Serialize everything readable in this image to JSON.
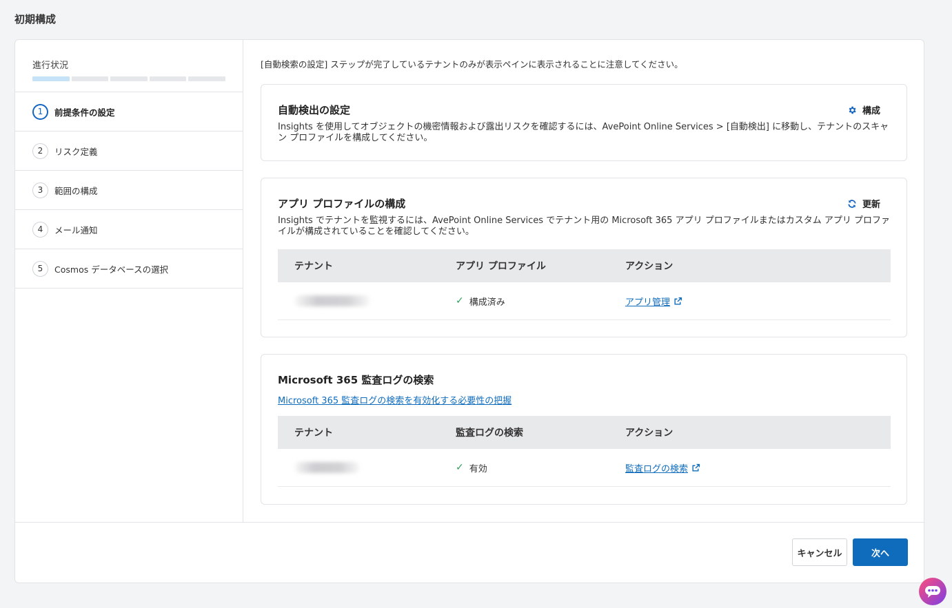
{
  "page": {
    "title": "初期構成"
  },
  "progress": {
    "label": "進行状況",
    "completed_steps": 1,
    "total_steps": 5
  },
  "steps": [
    {
      "num": "1",
      "label": "前提条件の設定",
      "active": true
    },
    {
      "num": "2",
      "label": "リスク定義",
      "active": false
    },
    {
      "num": "3",
      "label": "範囲の構成",
      "active": false
    },
    {
      "num": "4",
      "label": "メール通知",
      "active": false
    },
    {
      "num": "5",
      "label": "Cosmos データベースの選択",
      "active": false
    }
  ],
  "notice": "[自動検索の設定] ステップが完了しているテナントのみが表示ペインに表示されることに注意してください。",
  "auto_detect": {
    "title": "自動検出の設定",
    "action_label": "構成",
    "description": "Insights を使用してオブジェクトの機密情報および露出リスクを確認するには、AvePoint Online Services > [自動検出] に移動し、テナントのスキャン プロファイルを構成してください。"
  },
  "app_profile": {
    "title": "アプリ プロファイルの構成",
    "action_label": "更新",
    "description": "Insights でテナントを監視するには、AvePoint Online Services でテナント用の Microsoft 365 アプリ プロファイルまたはカスタム アプリ プロファイルが構成されていることを確認してください。",
    "columns": [
      "テナント",
      "アプリ プロファイル",
      "アクション"
    ],
    "row": {
      "status": "構成済み",
      "action": "アプリ管理"
    }
  },
  "audit_log": {
    "title": "Microsoft 365 監査ログの検索",
    "link": "Microsoft 365 監査ログの検索を有効化する必要性の把握",
    "columns": [
      "テナント",
      "監査ログの検索",
      "アクション"
    ],
    "row": {
      "status": "有効",
      "action": "監査ログの検索"
    }
  },
  "footer": {
    "cancel": "キャンセル",
    "next": "次へ"
  },
  "colors": {
    "accent": "#0f6cbd",
    "success": "#2e9e5b",
    "progress_done": "#c6e2f6"
  }
}
